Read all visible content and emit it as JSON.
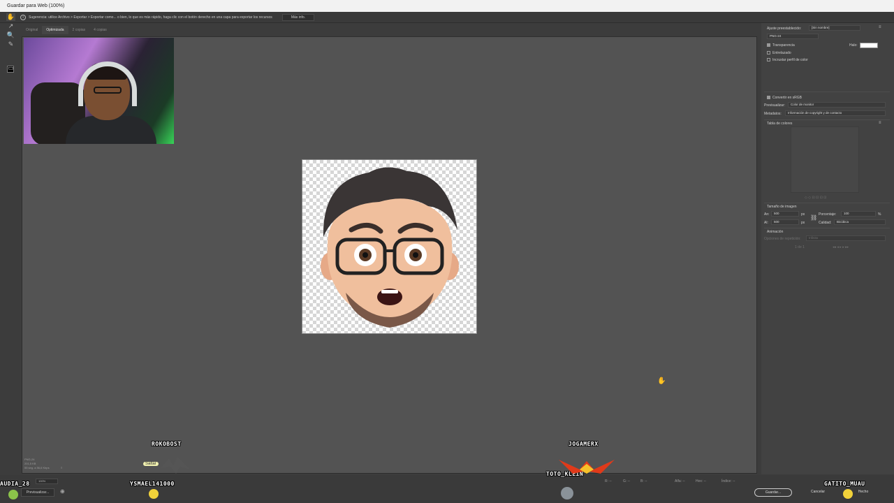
{
  "window": {
    "title": "Guardar para Web (100%)"
  },
  "hint": {
    "text": "Sugerencia: utilice Archivo > Exportar > Exportar como... o bien, lo que es más rápido, haga clic con el botón derecho en una capa para exportar los recursos",
    "more_button": "Más info."
  },
  "view_tabs": [
    "Original",
    "Optimizada",
    "2 copias",
    "4 copias"
  ],
  "status": {
    "format": "PNG-24",
    "size": "201,5 KB",
    "speed": "55 seg. a 56,6 Kbps"
  },
  "bottom": {
    "zoom": "100%",
    "r_label": "R: --",
    "g_label": "G: --",
    "b_label": "B: --",
    "alpha_label": "Alfa: --",
    "hex_label": "Hex: --",
    "index_label": "Índice: --",
    "preview_button": "Previsualizar...",
    "save_button": "Guardar...",
    "cancel_button": "Cancelar",
    "done_button": "Hecho"
  },
  "settings": {
    "preset_label": "Ajuste preestablecido:",
    "preset_value": "[Sin nombre]",
    "format_value": "PNG-24",
    "transparency": {
      "label": "Transparencia",
      "checked": true
    },
    "matte_label": "Halo:",
    "interlaced": {
      "label": "Entrelazado",
      "checked": false
    },
    "embed_profile": {
      "label": "Incrustar perfil de color",
      "checked": false
    },
    "convert_srgb": {
      "label": "Convertir en sRGB",
      "checked": true
    },
    "preview_label": "Previsualizar:",
    "preview_value": "Color de monitor",
    "metadata_label": "Metadatos:",
    "metadata_value": "Información de copyright y de contacto",
    "color_table_label": "Tabla de colores",
    "image_size_label": "Tamaño de imagen",
    "width_label": "An:",
    "width_value": "500",
    "height_label": "Al:",
    "height_value": "500",
    "unit": "px",
    "percent_label": "Porcentaje:",
    "percent_value": "100",
    "percent_unit": "%",
    "quality_label": "Calidad:",
    "quality_value": "Bicúbica",
    "animation_label": "Animación",
    "loop_label": "Opciones de repetición:",
    "loop_value": "Infinito",
    "frame_counter": "1 de 1"
  },
  "stream_overlay": {
    "names": [
      "ROKOBOST",
      "JOGAMERX",
      "YSMAEL141000",
      "TOTO_KLEIN",
      "GATITO_MUAU",
      "AUDIA_28"
    ],
    "tag": "Saltar"
  },
  "colors": {
    "canvas": "#535353",
    "panel": "#424242",
    "accent": "#ffffff"
  }
}
